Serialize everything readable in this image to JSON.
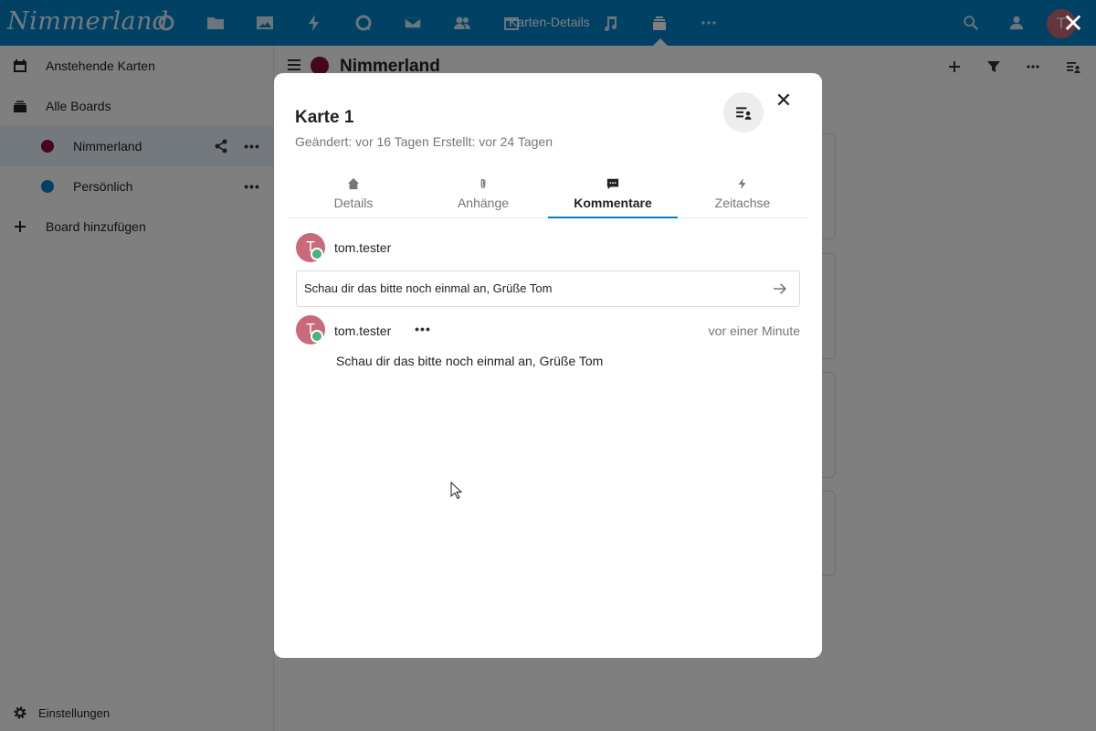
{
  "header": {
    "logo_text": "Nimmerland",
    "title": "Karten-Details",
    "app_icons": [
      "dashboard-icon",
      "files-icon",
      "photos-icon",
      "activity-icon",
      "talk-icon",
      "mail-icon",
      "contacts-icon",
      "calendar-icon",
      "music-icon",
      "deck-icon",
      "more-apps-icon"
    ],
    "user_initial": "T",
    "accent_color": "#0082c9"
  },
  "sidebar": {
    "items": [
      {
        "label": "Anstehende Karten",
        "icon": "calendar-icon"
      },
      {
        "label": "Alle Boards",
        "icon": "deck-icon"
      },
      {
        "label": "Nimmerland",
        "color": "#8b0c3c",
        "active": true
      },
      {
        "label": "Persönlich",
        "color": "#0082c9"
      },
      {
        "label": "Board hinzufügen",
        "icon": "plus-icon"
      }
    ],
    "settings_label": "Einstellungen"
  },
  "main": {
    "board_title": "Nimmerland",
    "board_color": "#8b0c3c"
  },
  "modal": {
    "title": "Karte 1",
    "subtitle": "Geändert: vor 16 Tagen Erstellt: vor 24 Tagen",
    "tabs": [
      {
        "label": "Details",
        "icon": "home-icon"
      },
      {
        "label": "Anhänge",
        "icon": "paperclip-icon"
      },
      {
        "label": "Kommentare",
        "icon": "comment-icon",
        "active": true
      },
      {
        "label": "Zeitachse",
        "icon": "activity-icon"
      }
    ],
    "composer": {
      "username": "tom.tester",
      "avatar_initial": "T",
      "input_value": "Schau dir das bitte noch einmal an, Grüße Tom"
    },
    "comments": [
      {
        "username": "tom.tester",
        "avatar_initial": "T",
        "time": "vor einer Minute",
        "text": "Schau dir das bitte noch einmal an, Grüße Tom"
      }
    ]
  }
}
